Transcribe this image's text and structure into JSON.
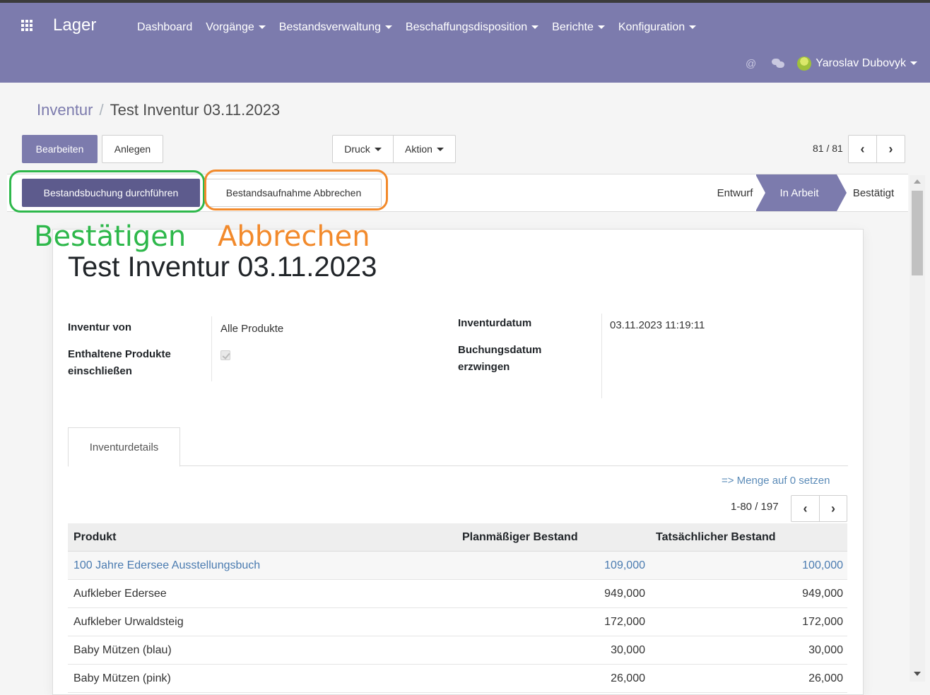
{
  "navbar": {
    "app_title": "Lager",
    "menu": [
      {
        "label": "Dashboard",
        "dropdown": false
      },
      {
        "label": "Vorgänge",
        "dropdown": true
      },
      {
        "label": "Bestandsverwaltung",
        "dropdown": true
      },
      {
        "label": "Beschaffungsdisposition",
        "dropdown": true
      },
      {
        "label": "Berichte",
        "dropdown": true
      },
      {
        "label": "Konfiguration",
        "dropdown": true
      }
    ],
    "at_symbol": "@",
    "user_name": "Yaroslav Dubovyk"
  },
  "breadcrumb": {
    "parent": "Inventur",
    "separator": "/",
    "current": "Test Inventur 03.11.2023"
  },
  "toolbar": {
    "edit_label": "Bearbeiten",
    "create_label": "Anlegen",
    "print_label": "Druck",
    "action_label": "Aktion",
    "pager_value": "81 / 81",
    "prev_glyph": "‹",
    "next_glyph": "›"
  },
  "statusbar": {
    "validate_label": "Bestandsbuchung durchführen",
    "cancel_label": "Bestandsaufnahme Abbrechen",
    "stages": [
      "Entwurf",
      "In Arbeit",
      "Bestätigt"
    ],
    "active_stage": "In Arbeit"
  },
  "annotations": {
    "green_text": "Bestätigen",
    "orange_text": "Abbrechen",
    "green_color": "#2eb84b",
    "orange_color": "#f28a2c"
  },
  "form": {
    "title": "Test Inventur 03.11.2023",
    "inventory_of_label": "Inventur von",
    "inventory_of_value": "Alle Produkte",
    "include_label_1": "Enthaltene Produkte",
    "include_label_2": "einschließen",
    "include_checked": true,
    "date_label": "Inventurdatum",
    "date_value": "03.11.2023 11:19:11",
    "force_label_1": "Buchungsdatum",
    "force_label_2": "erzwingen"
  },
  "tabs": {
    "details_label": "Inventurdetails"
  },
  "lines": {
    "set_zero_link": "=> Menge auf 0 setzen",
    "pager_value": "1-80 / 197",
    "columns": [
      "Produkt",
      "Planmäßiger Bestand",
      "Tatsächlicher Bestand"
    ],
    "rows": [
      {
        "product": "100 Jahre Edersee Ausstellungsbuch",
        "planned": "109,000",
        "actual": "100,000"
      },
      {
        "product": "Aufkleber Edersee",
        "planned": "949,000",
        "actual": "949,000"
      },
      {
        "product": "Aufkleber Urwaldsteig",
        "planned": "172,000",
        "actual": "172,000"
      },
      {
        "product": "Baby Mützen (blau)",
        "planned": "30,000",
        "actual": "30,000"
      },
      {
        "product": "Baby Mützen (pink)",
        "planned": "26,000",
        "actual": "26,000"
      }
    ]
  },
  "colors": {
    "brand": "#7c7bad",
    "brand_dark": "#5d5b8d",
    "link": "#4a7bb0"
  }
}
